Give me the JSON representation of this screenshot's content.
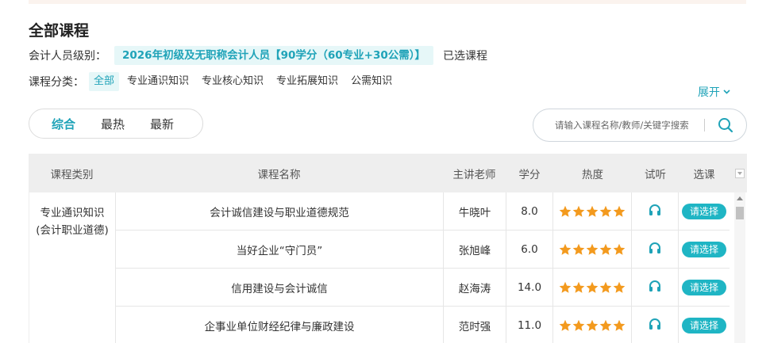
{
  "page": {
    "title": "全部课程"
  },
  "level": {
    "label": "会计人员级别：",
    "value": "2026年初级及无职称会计人员【90学分（60专业+30公需）】",
    "selected_link": "已选课程"
  },
  "categories": {
    "label": "课程分类：",
    "items": [
      {
        "label": "全部",
        "active": true
      },
      {
        "label": "专业通识知识",
        "active": false
      },
      {
        "label": "专业核心知识",
        "active": false
      },
      {
        "label": "专业拓展知识",
        "active": false
      },
      {
        "label": "公需知识",
        "active": false
      }
    ],
    "expand_label": "展开"
  },
  "sort": {
    "items": [
      {
        "label": "综合",
        "active": true
      },
      {
        "label": "最热",
        "active": false
      },
      {
        "label": "最新",
        "active": false
      }
    ]
  },
  "search": {
    "placeholder": "请输入课程名称/教师/关键字搜索",
    "icon": "search-icon"
  },
  "table": {
    "headers": [
      "课程类别",
      "课程名称",
      "主讲老师",
      "学分",
      "热度",
      "试听",
      "选课"
    ],
    "group": "专业通识知识（会计职业道德）",
    "group_line1": "专业通识知识",
    "group_line2": "(会计职业道德)",
    "rows": [
      {
        "name": "会计诚信建设与职业道德规范",
        "teacher": "牛晓叶",
        "credit": "8.0",
        "stars": 5,
        "select_label": "请选择"
      },
      {
        "name": "当好企业“守门员”",
        "teacher": "张旭峰",
        "credit": "6.0",
        "stars": 5,
        "select_label": "请选择"
      },
      {
        "name": "信用建设与会计诚信",
        "teacher": "赵海涛",
        "credit": "14.0",
        "stars": 5,
        "select_label": "请选择"
      },
      {
        "name": "企事业单位财经纪律与廉政建设",
        "teacher": "范时强",
        "credit": "11.0",
        "stars": 5,
        "select_label": "请选择"
      }
    ]
  },
  "colors": {
    "accent": "#1fa3b8",
    "button": "#1fb5c4",
    "star": "#f39a1e",
    "tag_bg": "#e6f7f8"
  }
}
